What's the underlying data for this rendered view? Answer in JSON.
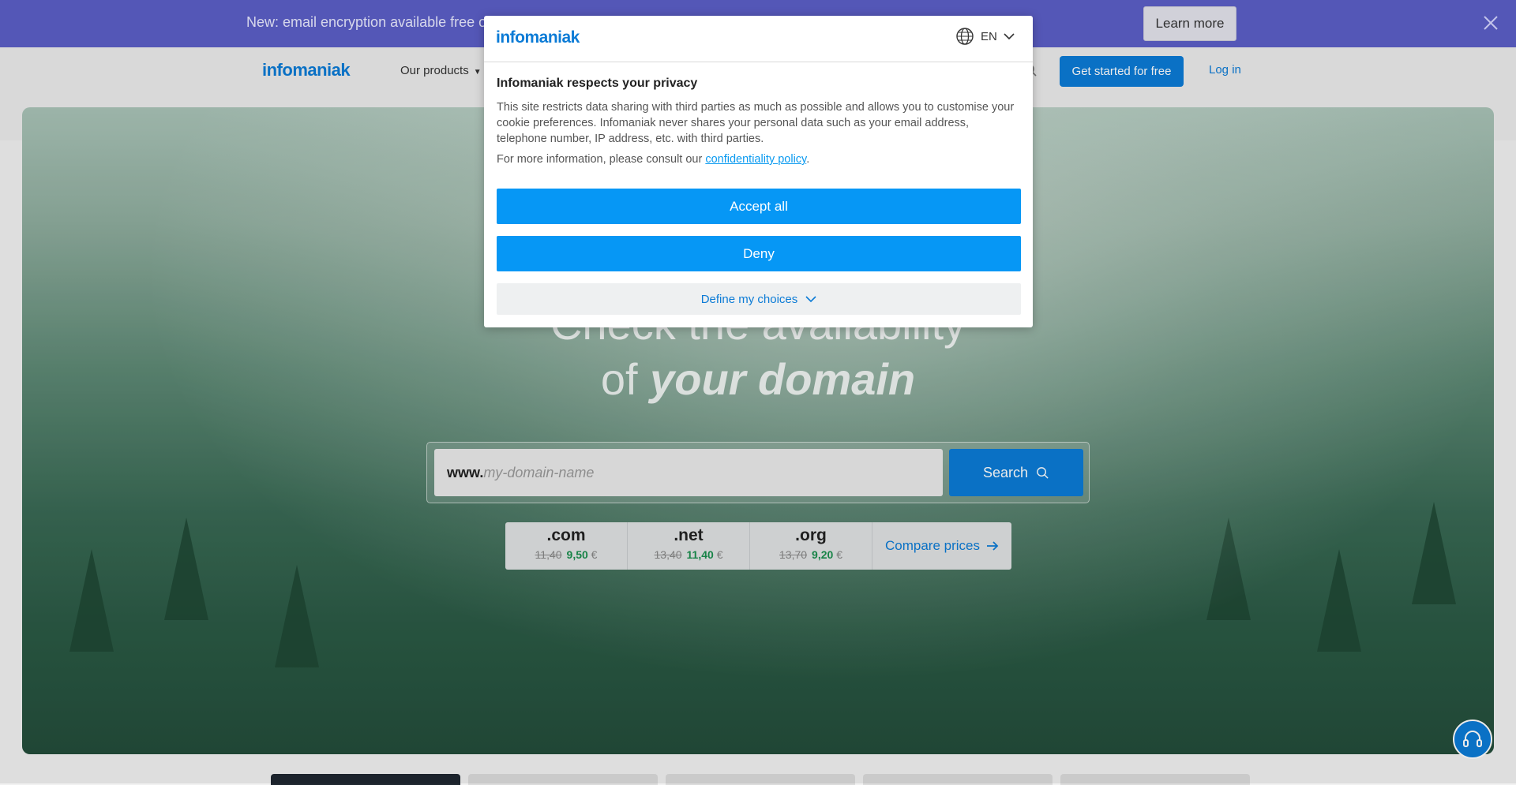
{
  "banner": {
    "text": "New: email encryption available free of c",
    "button_label": "Learn more",
    "close_glyph": "✕"
  },
  "header": {
    "logo": "infomaniak",
    "nav_products": "Our products",
    "start_button": "Get started for free",
    "login": "Log in"
  },
  "hero": {
    "title_line1": "Check the availability",
    "title_of": "of",
    "title_em": "your domain",
    "search": {
      "prefix": "www.",
      "placeholder": "my-domain-name",
      "button_label": "Search"
    },
    "tlds": [
      {
        "name": ".com",
        "old_price": "11,40",
        "new_price": "9,50",
        "currency": "€"
      },
      {
        "name": ".net",
        "old_price": "13,40",
        "new_price": "11,40",
        "currency": "€"
      },
      {
        "name": ".org",
        "old_price": "13,70",
        "new_price": "9,20",
        "currency": "€"
      }
    ],
    "compare_label": "Compare prices"
  },
  "cookie_modal": {
    "logo": "infomaniak",
    "language": "EN",
    "title": "Infomaniak respects your privacy",
    "body": "This site restricts data sharing with third parties as much as possible and allows you to customise your cookie preferences. Infomaniak never shares your personal data such as your email address, telephone number, IP address, etc. with third parties.",
    "more_prefix": "For more information, please consult our ",
    "more_link": "confidentiality policy",
    "more_suffix": ".",
    "accept_label": "Accept all",
    "deny_label": "Deny",
    "define_label": "Define my choices"
  },
  "colors": {
    "brand_blue": "#0b7bd6",
    "banner_purple": "#5c5fc7",
    "cookie_button": "#0697f5",
    "price_green": "#1a8f4e"
  },
  "icons": [
    "close-icon",
    "caret-down-icon",
    "search-icon",
    "globe-icon",
    "chevron-down-icon",
    "arrow-right-icon",
    "headset-icon"
  ]
}
